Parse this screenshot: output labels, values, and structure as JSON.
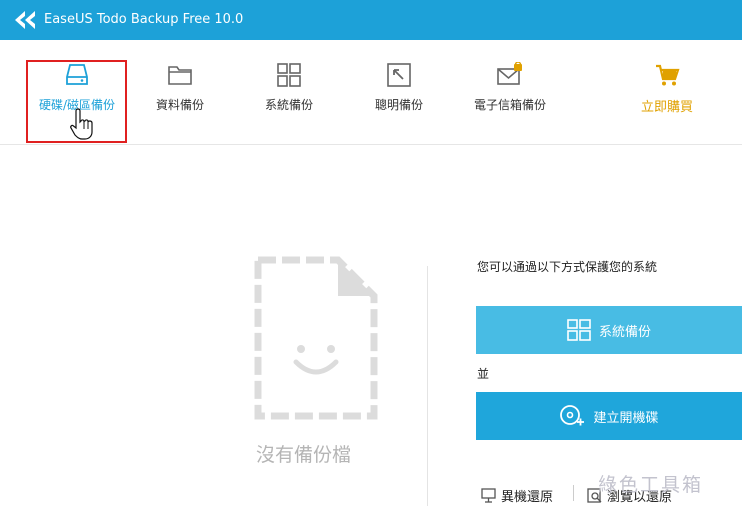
{
  "window": {
    "title": "EaseUS Todo Backup Free 10.0"
  },
  "toolbar": {
    "items": [
      {
        "label": "硬碟/磁區備份",
        "icon": "hard-drive-icon",
        "active": true
      },
      {
        "label": "資料備份",
        "icon": "folder-icon"
      },
      {
        "label": "系統備份",
        "icon": "windows-icon"
      },
      {
        "label": "聰明備份",
        "icon": "smart-backup-icon"
      },
      {
        "label": "電子信箱備份",
        "icon": "email-lock-icon"
      }
    ],
    "buy": {
      "label": "立即購買",
      "icon": "cart-icon"
    }
  },
  "main": {
    "empty_text": "沒有備份檔",
    "tip": "您可以通過以下方式保護您的系統",
    "system_backup_button": "系統備份",
    "and_text": "並",
    "create_disk_button": "建立開機碟",
    "links": {
      "restore_other": "異機還原",
      "browse_restore": "瀏覽以還原"
    }
  },
  "watermark": "綠色工具箱",
  "colors": {
    "accent": "#1da1d8",
    "buy": "#e0a100",
    "highlight": "#e02020"
  }
}
